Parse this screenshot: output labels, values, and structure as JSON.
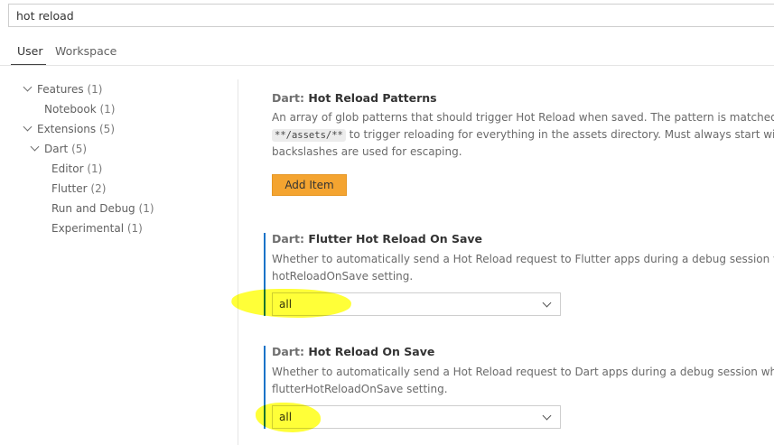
{
  "search": {
    "value": "hot reload"
  },
  "tabs": [
    {
      "label": "User"
    },
    {
      "label": "Workspace"
    }
  ],
  "tree": [
    {
      "label": "Features",
      "count": "(1)"
    },
    {
      "label": "Notebook",
      "count": "(1)"
    },
    {
      "label": "Extensions",
      "count": "(5)"
    },
    {
      "label": "Dart",
      "count": "(5)"
    },
    {
      "label": "Editor",
      "count": "(1)"
    },
    {
      "label": "Flutter",
      "count": "(2)"
    },
    {
      "label": "Run and Debug",
      "count": "(1)"
    },
    {
      "label": "Experimental",
      "count": "(1)"
    }
  ],
  "settings": [
    {
      "category": "Dart: ",
      "title": "Hot Reload Patterns",
      "desc1": "An array of glob patterns that should trigger Hot Reload when saved. The pattern is matched aga",
      "desc2_code": "**/assets/**",
      "desc2_text": " to trigger reloading for everything in the assets directory. Must always start with \"**",
      "desc3": "backslashes are used for escaping.",
      "button": "Add Item"
    },
    {
      "category": "Dart: ",
      "title": "Flutter Hot Reload On Save",
      "desc1": "Whether to automatically send a Hot Reload request to Flutter apps during a debug session wher",
      "desc2": "hotReloadOnSave setting.",
      "value": "all"
    },
    {
      "category": "Dart: ",
      "title": "Hot Reload On Save",
      "desc1": "Whether to automatically send a Hot Reload request to Dart apps during a debug session when s",
      "desc2": "flutterHotReloadOnSave setting.",
      "value": "all"
    }
  ],
  "colors": {
    "accent": "#1a73c8",
    "button": "#f4a430",
    "highlight": "#ffff00"
  }
}
